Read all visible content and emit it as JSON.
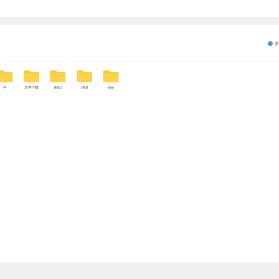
{
  "toolbar": {
    "action": {
      "icon": "circle-icon",
      "label": "新",
      "color": "#4a90e2"
    }
  },
  "folders": [
    {
      "name": "户",
      "icon": "folder-icon"
    },
    {
      "name": "文件下载",
      "icon": "folder-icon"
    },
    {
      "name": "test1",
      "icon": "folder-icon"
    },
    {
      "name": "xlxd",
      "icon": "folder-icon"
    },
    {
      "name": "xyy",
      "icon": "folder-icon"
    }
  ],
  "colors": {
    "folder": "#ffd24a",
    "folder_tab": "#f7c53a",
    "background_strip": "#f0f0f2"
  }
}
